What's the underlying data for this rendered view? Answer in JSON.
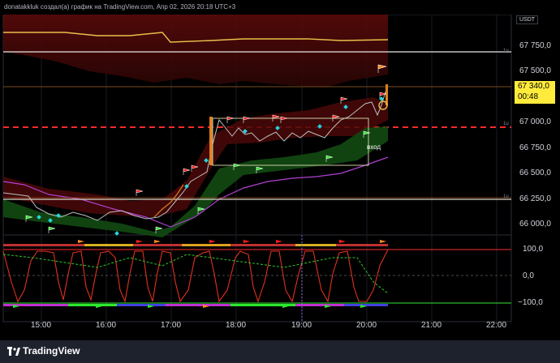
{
  "header": {
    "attribution": "donatakkluk создал(а) график на TradingView.com, Апр 02, 2026 20:18 UTC+3"
  },
  "price_axis": {
    "currency": "USDT",
    "labels": [
      "67 750,0",
      "67 500,0",
      "67 000,0",
      "66 750,0",
      "66 500,0",
      "66 250,0",
      "66 000,0"
    ],
    "current_price": "67 340,0",
    "countdown": "00:48"
  },
  "oscillator_axis": {
    "labels": [
      "100,0",
      "0,0",
      "−100,0"
    ]
  },
  "time_axis": {
    "labels": [
      "15:00",
      "16:00",
      "17:00",
      "18:00",
      "19:00",
      "20:00",
      "21:00",
      "22:00"
    ]
  },
  "annotations": {
    "entry_label": "вход"
  },
  "footer": {
    "brand": "TradingView"
  },
  "colors": {
    "background": "#000000",
    "current_price_bg": "#ffeb3b",
    "dashed_line": "#ff2b2b",
    "flag_red": "#ff1e1e",
    "flag_green": "#2ee82e",
    "flag_orange": "#ff8a1e"
  }
}
